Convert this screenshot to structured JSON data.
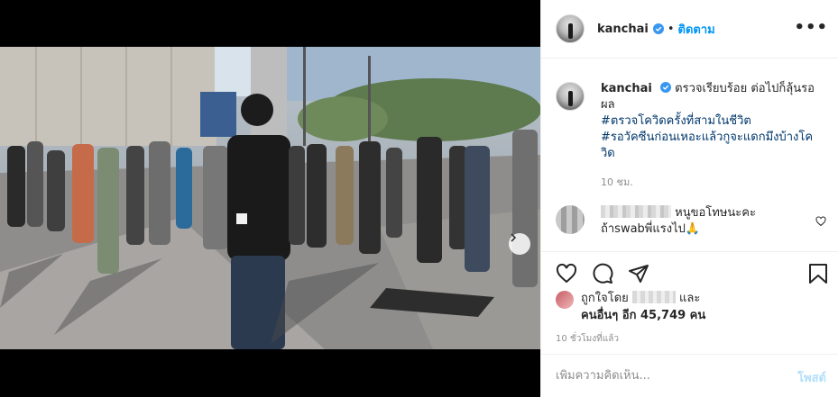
{
  "post": {
    "username": "kanchai",
    "follow_label": "ติดตาม",
    "separator": "•",
    "more_icon": "more-horizontal-icon"
  },
  "caption": {
    "username": "kanchai",
    "text": "ตรวจเรียบร้อย ต่อไปก็ลุ้นรอผล",
    "hashtags": [
      "#ตรวจโควิดครั้งที่สามในชีวิต",
      "#รอวัคซีนก่อนเหอะแล้วกูจะแดกมึงบ้างโควิด"
    ],
    "time": "10 ชม."
  },
  "comment": {
    "text": "หนูขอโทษนะคะ ถ้าswabพี่แรงไป🙏"
  },
  "likes": {
    "liked_by_prefix": "ถูกใจโดย",
    "and": "และ",
    "others": "คนอื่นๆ อีก 45,749 คน"
  },
  "timestamp": "10 ชั่วโมงที่แล้ว",
  "composer": {
    "placeholder": "เพิ่มความคิดเห็น...",
    "post_label": "โพสต์"
  },
  "carousel": {
    "slide_count": 3,
    "active_index": 0
  },
  "colors": {
    "link": "#0095f6",
    "hashtag": "#00376b",
    "muted": "#8e8e8e",
    "carousel_active": "#3a9cf0"
  }
}
